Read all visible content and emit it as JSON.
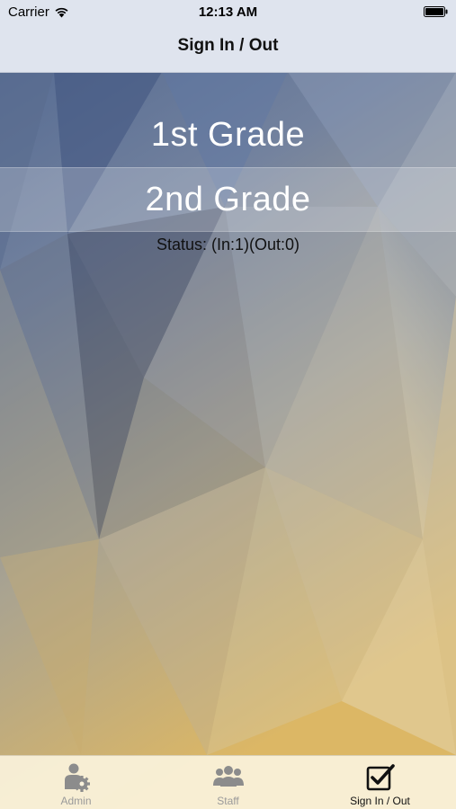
{
  "status_bar": {
    "carrier": "Carrier",
    "time": "12:13 AM"
  },
  "nav": {
    "title": "Sign In / Out"
  },
  "grades": [
    {
      "label": "1st Grade"
    },
    {
      "label": "2nd Grade"
    }
  ],
  "status": {
    "text": "Status: (In:1)(Out:0)"
  },
  "tabbar": {
    "tabs": [
      {
        "label": "Admin",
        "icon": "admin-gear-user-icon",
        "active": false
      },
      {
        "label": "Staff",
        "icon": "group-people-icon",
        "active": false
      },
      {
        "label": "Sign In / Out",
        "icon": "checkbox-checked-icon",
        "active": true
      }
    ]
  },
  "colors": {
    "active_tab": "#111111",
    "inactive_tab": "#9a9a9a",
    "nav_bg": "#dfe4ee",
    "tabbar_bg": "#faf2dc"
  }
}
